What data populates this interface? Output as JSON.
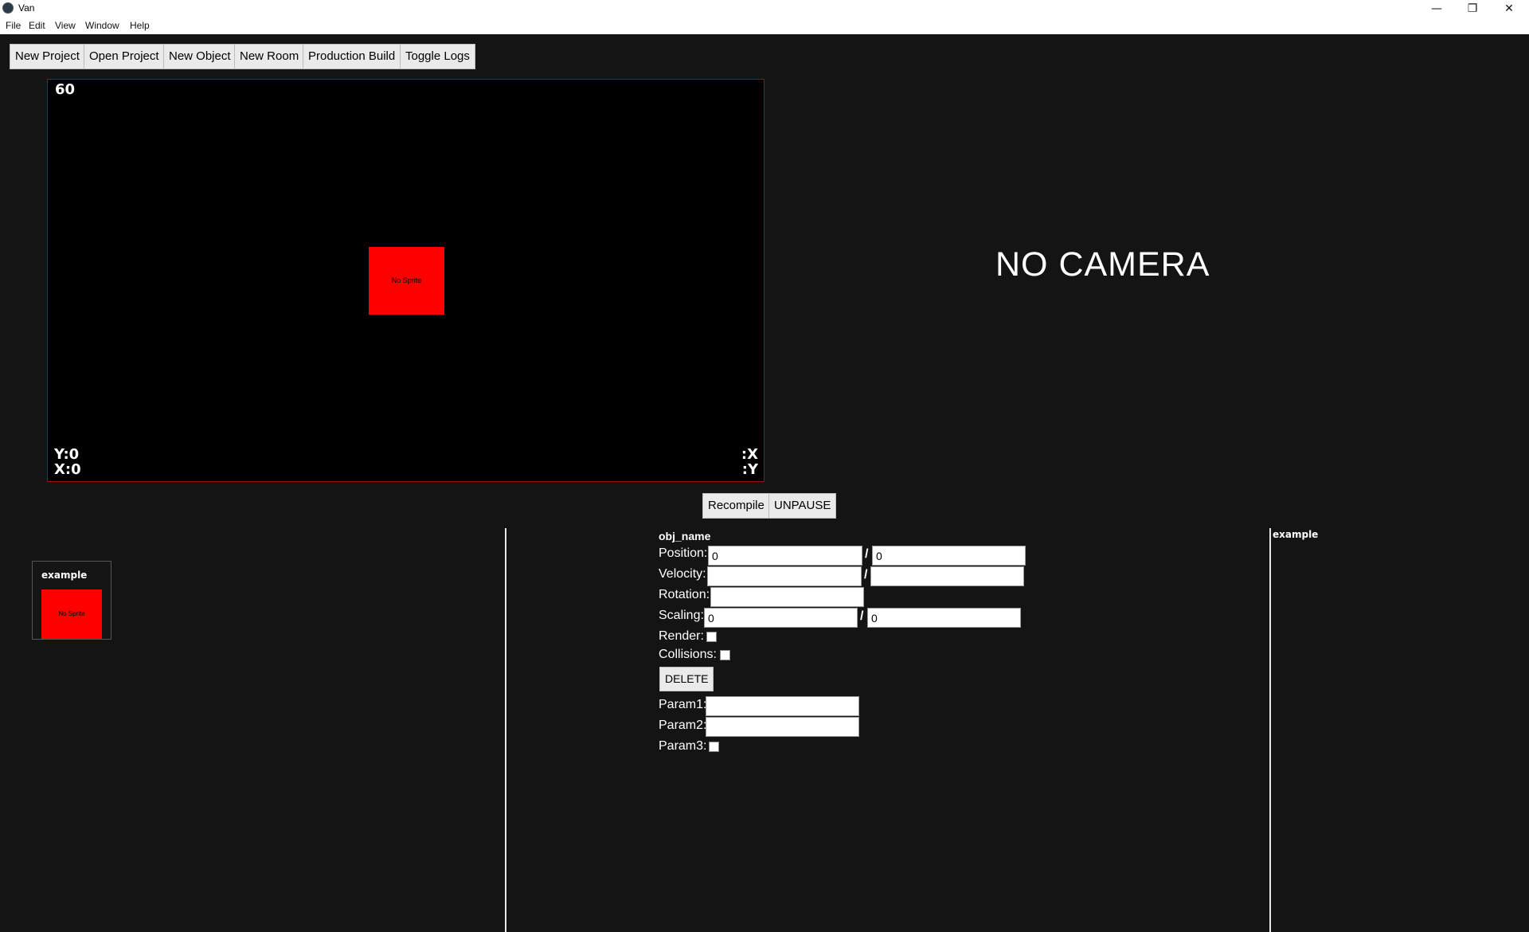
{
  "window": {
    "title": "Van",
    "controls": {
      "minimize": "—",
      "maximize": "❐",
      "close": "✕"
    }
  },
  "menu": [
    "File",
    "Edit",
    "View",
    "Window",
    "Help"
  ],
  "toolbar": [
    "New Project",
    "Open Project",
    "New Object",
    "New Room",
    "Production Build",
    "Toggle Logs"
  ],
  "viewport": {
    "fps": "60",
    "sprite_label": "No Sprite",
    "bottom_left": {
      "y": "Y:0",
      "x": "X:0"
    },
    "bottom_right": {
      "x": ":X",
      "y": ":Y"
    }
  },
  "camera": {
    "message": "NO CAMERA"
  },
  "controls": {
    "recompile": "Recompile",
    "unpause": "UNPAUSE"
  },
  "objects": [
    {
      "name": "example",
      "sprite_label": "No Sprite"
    }
  ],
  "properties": {
    "title": "obj_name",
    "position": {
      "label": "Position:",
      "x": "0",
      "y": "0"
    },
    "velocity": {
      "label": "Velocity:",
      "x": "",
      "y": ""
    },
    "rotation": {
      "label": "Rotation:",
      "value": ""
    },
    "scaling": {
      "label": "Scaling:",
      "x": "0",
      "y": "0"
    },
    "render": {
      "label": "Render:",
      "checked": false
    },
    "collisions": {
      "label": "Collisions:",
      "checked": false
    },
    "delete_label": "DELETE",
    "param1": {
      "label": "Param1:",
      "value": ""
    },
    "param2": {
      "label": "Param2:",
      "value": ""
    },
    "param3": {
      "label": "Param3:",
      "checked": false
    },
    "separator": "/"
  },
  "right_panel": {
    "title": "example"
  },
  "colors": {
    "background": "#141414",
    "viewport": "#000000",
    "viewport_border": "#9a0f0f",
    "sprite": "#ff0000"
  }
}
